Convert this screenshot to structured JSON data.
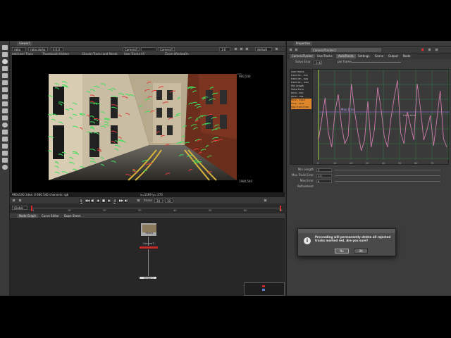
{
  "viewer": {
    "tab_label": "Viewer1",
    "toolbar1": {
      "channel_select": "rgba",
      "alpha_select": "rgba.alpha",
      "gain_value": "4:0.0",
      "input_a": "CameraT...",
      "input_b": "CameraT...",
      "gamma_value": "1:0",
      "lut_select": "default"
    },
    "toolbar2": {
      "add_user_track_label": "Add User Track",
      "thumbnails_label": "Thumbnails",
      "thumbnails_value": "Hidden",
      "display_label": "Display",
      "display_value": "Tracks and Points",
      "user_tracks_label": "User Tracks",
      "user_tracks_value": "All",
      "zoom_window_label": "Zoom Window",
      "zoom_window_value": "On"
    },
    "canvas_corner_top": "960,540",
    "canvas_corner_bottom": "1980,540",
    "status_left": "960x540 1dex: 0 960 540 channels: rgb",
    "status_mid": "x=1169 y= 273",
    "frame_label": "frame",
    "frame_value": "34",
    "fps_value": "10",
    "timeline_mode": "Global",
    "timeline_ticks": [
      "1",
      "10",
      "20",
      "30",
      "40",
      "50",
      "60",
      "70"
    ]
  },
  "node_graph": {
    "tabs": [
      "Node Graph",
      "Curve Editor",
      "Dope Sheet"
    ],
    "read_node_label": "Read1",
    "read_node_file": "rgb_camera_1.png",
    "tracker_node_label": "CameraT...",
    "viewer_node_label": "Viewer1"
  },
  "properties": {
    "title": "Properties",
    "node_name": "CameraTracker1",
    "tabs": [
      "CameraTracker",
      "UserTracks",
      "AutoTracks",
      "Settings",
      "Scene",
      "Output",
      "Node"
    ],
    "solve_error_label": "Solve Error",
    "solve_error_value": "0.48",
    "per_frame_label": "per frame",
    "list_items": [
      "num tracks",
      "track len - min",
      "track len - avg",
      "track len - max",
      "Min Length",
      "Solve Error",
      "error - min",
      "error - rms",
      "error - track",
      "error - max",
      "Max Track Error"
    ],
    "graph_labels": {
      "max_error": "Max Error",
      "track_error": "track error"
    },
    "x_ticks": [
      "0",
      "10",
      "20",
      "30",
      "40",
      "50",
      "60",
      "70"
    ],
    "rows": [
      {
        "label": "Min Length",
        "value": "3"
      },
      {
        "label": "Max Track Error",
        "value": "1.5"
      },
      {
        "label": "Max Error",
        "value": "6"
      },
      {
        "label": "Refinement",
        "value": ""
      }
    ]
  },
  "dialog": {
    "title": "",
    "message": "Proceeding will permanently delete all rejected tracks marked red. Are you sure?",
    "no_label": "No",
    "yes_label": "OK"
  },
  "colors": {
    "accent": "#d62a2a",
    "graph_line": "#d27dae",
    "threshold_line": "#8a6bd0",
    "graph_grid": "#2ea84a"
  }
}
